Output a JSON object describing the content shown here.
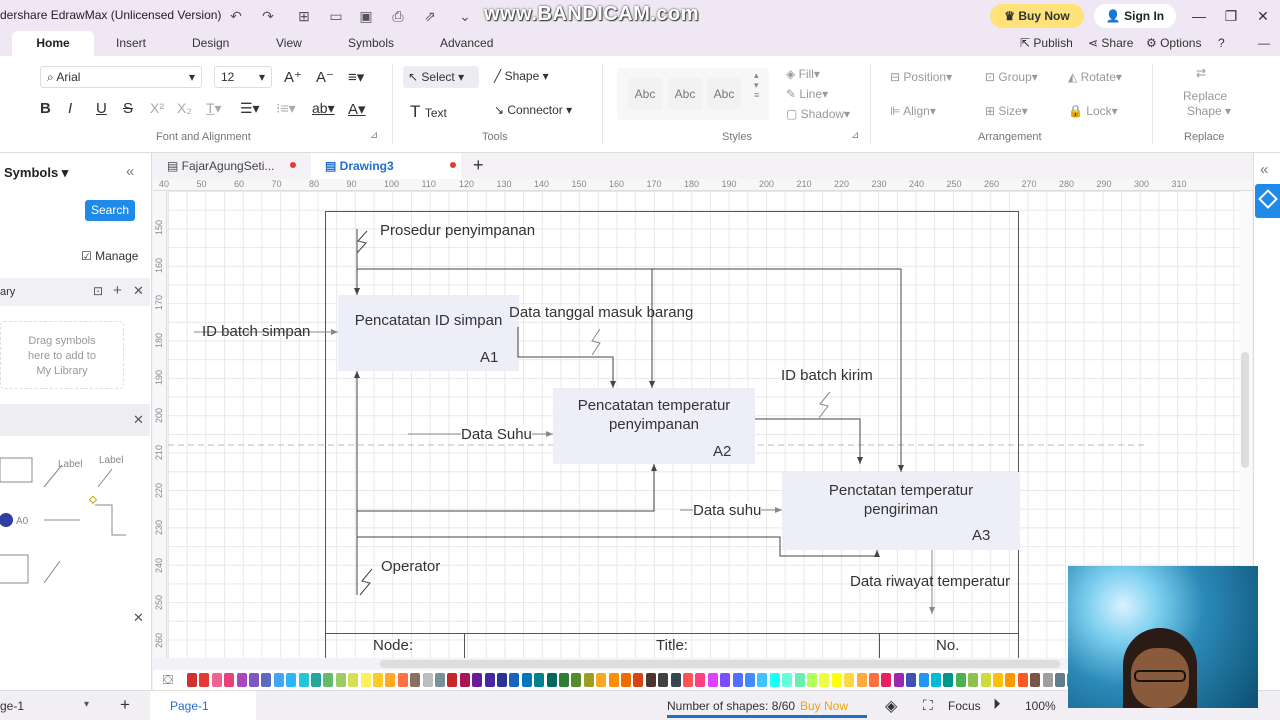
{
  "titlebar": {
    "app_title": "dershare EdrawMax (Unlicensed Version)",
    "watermark": "www.BANDICAM.com",
    "buy_now": "Buy Now",
    "sign_in": "Sign In"
  },
  "menu": {
    "tabs": [
      "Home",
      "Insert",
      "Design",
      "View",
      "Symbols",
      "Advanced"
    ],
    "publish": "Publish",
    "share": "Share",
    "options": "Options"
  },
  "ribbon": {
    "font_family": "Arial",
    "font_size": "12",
    "group_font": "Font and Alignment",
    "select": "Select",
    "shape": "Shape",
    "text": "Text",
    "connector": "Connector",
    "group_tools": "Tools",
    "style_samples": [
      "Abc",
      "Abc",
      "Abc"
    ],
    "group_styles": "Styles",
    "fill": "Fill",
    "line": "Line",
    "shadow": "Shadow",
    "position": "Position",
    "group": "Group",
    "rotate": "Rotate",
    "align": "Align",
    "size": "Size",
    "lock": "Lock",
    "group_arrangement": "Arrangement",
    "replace_shape_line1": "Replace",
    "replace_shape_line2": "Shape",
    "group_replace": "Replace"
  },
  "left_panel": {
    "title": "Symbols",
    "search_button": "Search",
    "manage": "Manage",
    "library": "ary",
    "drag_hint": [
      "Drag symbols",
      "here to add to",
      "My Library"
    ],
    "sample_labels": [
      "Label",
      "Label",
      "A0"
    ]
  },
  "doc_tabs": {
    "tab1": "FajarAgungSeti...",
    "tab2": "Drawing3"
  },
  "rulers": {
    "h_ticks": [
      "40",
      "50",
      "60",
      "70",
      "80",
      "90",
      "100",
      "110",
      "120",
      "130",
      "140",
      "150",
      "160",
      "170",
      "180",
      "190",
      "200",
      "210",
      "220",
      "230",
      "240",
      "250",
      "260",
      "270",
      "280",
      "290",
      "300",
      "310"
    ],
    "v_ticks": [
      "150",
      "160",
      "170",
      "180",
      "190",
      "200",
      "210",
      "220",
      "230",
      "240",
      "250",
      "260"
    ]
  },
  "diagram": {
    "a1_title": "Pencatatan ID simpan",
    "a1_id": "A1",
    "a2_title": "Pencatatan temperatur penyimpanan",
    "a2_id": "A2",
    "a3_title": "Penctatan temperatur pengiriman",
    "a3_id": "A3",
    "label_prosedur": "Prosedur penyimpanan",
    "label_id_batch_simpan": "ID batch simpan",
    "label_data_tanggal": "Data tanggal masuk barang",
    "label_id_batch_kirim": "ID batch kirim",
    "label_data_suhu_1": "Data Suhu",
    "label_data_suhu_2": "Data suhu",
    "label_operator": "Operator",
    "label_data_riwayat": "Data riwayat temperatur",
    "footer_node": "Node:",
    "footer_title": "Title:",
    "footer_no": "No."
  },
  "palette_colors": [
    "#d32f2f",
    "#e53935",
    "#f06292",
    "#ec407a",
    "#ab47bc",
    "#7e57c2",
    "#5c6bc0",
    "#42a5f5",
    "#29b6f6",
    "#26c6da",
    "#26a69a",
    "#66bb6a",
    "#9ccc65",
    "#d4e157",
    "#ffee58",
    "#ffca28",
    "#ffa726",
    "#ff7043",
    "#8d6e63",
    "#bdbdbd",
    "#78909c",
    "#c62828",
    "#ad1457",
    "#6a1b9a",
    "#4527a0",
    "#283593",
    "#1565c0",
    "#0277bd",
    "#00838f",
    "#00695c",
    "#2e7d32",
    "#558b2f",
    "#9e9d24",
    "#f9a825",
    "#ff8f00",
    "#ef6c00",
    "#d84315",
    "#4e342e",
    "#424242",
    "#37474f",
    "#ff5252",
    "#ff4081",
    "#e040fb",
    "#7c4dff",
    "#536dfe",
    "#448aff",
    "#40c4ff",
    "#18ffff",
    "#64ffda",
    "#69f0ae",
    "#b2ff59",
    "#eeff41",
    "#ffff00",
    "#ffd740",
    "#ffab40",
    "#ff6e40",
    "#e91e63",
    "#9c27b0",
    "#3f51b5",
    "#2196f3",
    "#00bcd4",
    "#009688",
    "#4caf50",
    "#8bc34a",
    "#cddc39",
    "#ffc107",
    "#ff9800",
    "#ff5722",
    "#795548",
    "#9e9e9e",
    "#607d8b",
    "#f44336",
    "#03a9f4",
    "#ffeb3b",
    "#00e676",
    "#651fff"
  ],
  "status": {
    "page_left": "ge-1",
    "page_tab": "Page-1",
    "shapes": "Number of shapes: 8/60",
    "buy_now": "Buy Now",
    "focus": "Focus",
    "zoom": "100%"
  },
  "colors": {
    "accent": "#1f8ae8",
    "buy_now_bg": "#ffe27a",
    "box_fill": "#eeeef9"
  }
}
